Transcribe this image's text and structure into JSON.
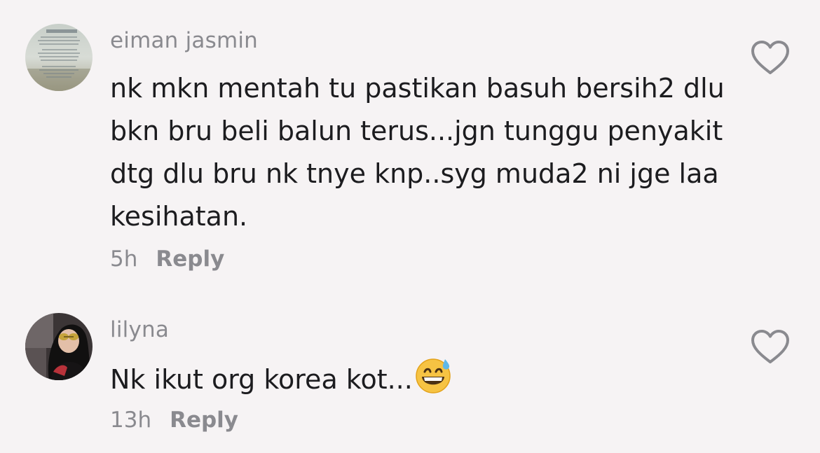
{
  "comments": [
    {
      "username": "eiman jasmin",
      "text": "nk mkn mentah tu pastikan basuh bersih2 dlu bkn bru beli balun terus...jgn tunggu penyakit dtg dlu bru nk tnye knp..syg muda2 ni jge laa kesihatan.",
      "time": "5h",
      "reply_label": "Reply",
      "like_icon": "heart-outline-icon"
    },
    {
      "username": "lilyna",
      "text": "Nk ikut org korea kot...",
      "emoji": "grinning-face-with-sweat-icon",
      "time": "13h",
      "reply_label": "Reply",
      "like_icon": "heart-outline-icon"
    }
  ],
  "colors": {
    "background": "#f6f3f4",
    "username": "#8a8a8f",
    "text": "#1c1c1f",
    "meta": "#8a8a8f",
    "heart_outline": "#8a8a8f"
  }
}
